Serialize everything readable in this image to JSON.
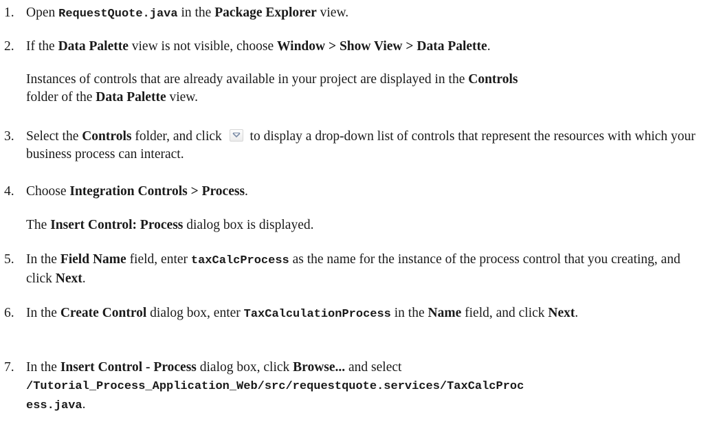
{
  "steps": [
    {
      "num": "1.",
      "parts": [
        {
          "t": "Open "
        },
        {
          "t": "RequestQuote.java",
          "s": "mono"
        },
        {
          "t": " in the "
        },
        {
          "t": "Package Explorer",
          "s": "b"
        },
        {
          "t": " view."
        }
      ]
    },
    {
      "num": "2.",
      "parts": [
        {
          "t": "If the "
        },
        {
          "t": "Data Palette",
          "s": "b"
        },
        {
          "t": " view is not visible, choose "
        },
        {
          "t": "Window > Show View > Data Palette",
          "s": "b"
        },
        {
          "t": "."
        }
      ]
    },
    {
      "num": "",
      "parts": [
        {
          "t": "Instances of controls that are already available in your project are displayed in the "
        },
        {
          "t": "Controls",
          "s": "b"
        },
        {
          "t": " folder of the "
        },
        {
          "t": "Data Palette",
          "s": "b"
        },
        {
          "t": " view."
        }
      ]
    },
    {
      "num": "3.",
      "parts": [
        {
          "t": "Select the "
        },
        {
          "t": "Controls",
          "s": "b"
        },
        {
          "t": " folder, and click "
        },
        {
          "icon": "dropdown-arrow-icon"
        },
        {
          "t": " to display a drop-down list of controls that represent the resources with which your business process can interact."
        }
      ]
    },
    {
      "num": "4.",
      "parts": [
        {
          "t": "Choose "
        },
        {
          "t": "Integration Controls > Process",
          "s": "b"
        },
        {
          "t": "."
        }
      ]
    },
    {
      "num": "",
      "parts": [
        {
          "t": "The "
        },
        {
          "t": "Insert Control: Process",
          "s": "b"
        },
        {
          "t": " dialog box is displayed."
        }
      ]
    },
    {
      "num": "5.",
      "parts": [
        {
          "t": "In the "
        },
        {
          "t": "Field Name",
          "s": "b"
        },
        {
          "t": " field, enter "
        },
        {
          "t": "taxCalcProcess",
          "s": "mono"
        },
        {
          "t": " as the name for the instance of the process control that you creating, and click "
        },
        {
          "t": "Next",
          "s": "b"
        },
        {
          "t": "."
        }
      ]
    },
    {
      "num": "6.",
      "parts": [
        {
          "t": "In the "
        },
        {
          "t": "Create Control",
          "s": "b"
        },
        {
          "t": " dialog box, enter "
        },
        {
          "t": "TaxCalculationProcess",
          "s": "mono"
        },
        {
          "t": " in the "
        },
        {
          "t": "Name",
          "s": "b"
        },
        {
          "t": " field, and click "
        },
        {
          "t": "Next",
          "s": "b"
        },
        {
          "t": "."
        }
      ]
    },
    {
      "num": "7.",
      "parts": [
        {
          "t": "In the "
        },
        {
          "t": "Insert Control - Process",
          "s": "b"
        },
        {
          "t": " dialog box, click "
        },
        {
          "t": "Browse...",
          "s": "b"
        },
        {
          "t": " and select "
        },
        {
          "t": "/Tutorial_Process_Application_Web/src/requestquote.services/TaxCalcProc",
          "s": "mono"
        },
        {
          "t": "ess.java",
          "s": "mono",
          "br": true
        },
        {
          "t": "."
        }
      ]
    }
  ],
  "colors": {
    "text": "#1a1a1a",
    "background": "#ffffff",
    "icon_arrow": "#7a8ba6"
  }
}
